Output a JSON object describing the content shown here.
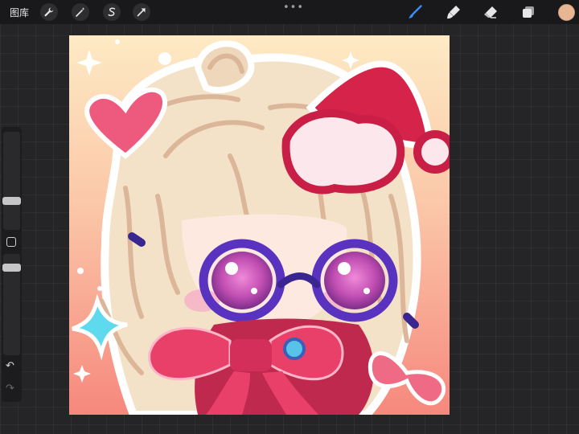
{
  "app": {
    "gallery_label": "图库",
    "menu_dots": "•••"
  },
  "toolbar_left": [
    {
      "name": "actions-wrench-icon"
    },
    {
      "name": "adjustments-wand-icon"
    },
    {
      "name": "selection-s-icon"
    },
    {
      "name": "transform-arrow-icon"
    }
  ],
  "toolbar_right": [
    {
      "name": "brush-icon",
      "active": true
    },
    {
      "name": "smudge-icon"
    },
    {
      "name": "eraser-icon"
    },
    {
      "name": "layers-icon"
    }
  ],
  "colors": {
    "active_color": "#e9b693",
    "active_tool": "#3b8cf0",
    "canvas_bg": "#fde6c6"
  },
  "sidebar": {
    "brush_size_level": 0.33,
    "opacity_level": 0.5,
    "undo_icon": "↶",
    "redo_icon": "↷"
  }
}
